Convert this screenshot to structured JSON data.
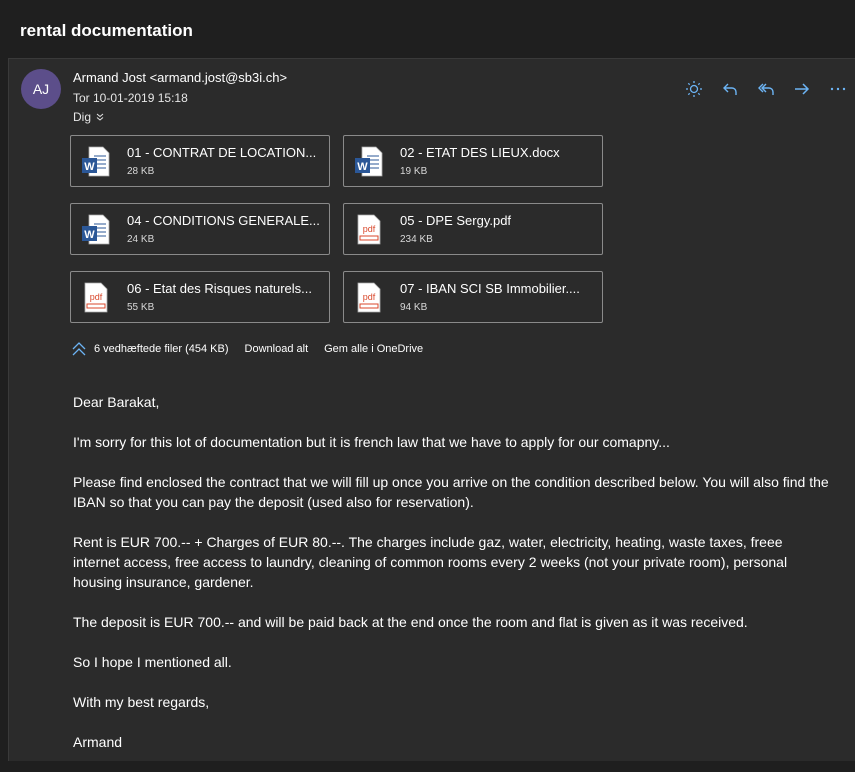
{
  "subject": "rental documentation",
  "message": {
    "avatar_initials": "AJ",
    "sender": "Armand Jost <armand.jost@sb3i.ch>",
    "date": "Tor 10-01-2019 15:18",
    "to_label": "Dig"
  },
  "actions": [
    {
      "icon": "brightness-icon"
    },
    {
      "icon": "reply-icon"
    },
    {
      "icon": "reply-all-icon"
    },
    {
      "icon": "forward-icon"
    },
    {
      "icon": "more-icon"
    }
  ],
  "attachments": [
    {
      "name": "01 - CONTRAT DE LOCATION...",
      "size": "28 KB",
      "type": "word"
    },
    {
      "name": "02 - ETAT DES LIEUX.docx",
      "size": "19 KB",
      "type": "word"
    },
    {
      "name": "04 - CONDITIONS GENERALE...",
      "size": "24 KB",
      "type": "word"
    },
    {
      "name": "05 - DPE Sergy.pdf",
      "size": "234 KB",
      "type": "pdf"
    },
    {
      "name": "06 - Etat des Risques naturels...",
      "size": "55 KB",
      "type": "pdf"
    },
    {
      "name": "07 - IBAN SCI SB Immobilier....",
      "size": "94 KB",
      "type": "pdf"
    }
  ],
  "attachment_summary": {
    "count_text": "6 vedhæftede filer (454 KB)",
    "download_all": "Download alt",
    "save_onedrive": "Gem alle i OneDrive"
  },
  "body": {
    "greeting": "Dear Barakat,",
    "p1": "I'm sorry for this lot of documentation but it is french law that we have to apply for our comapny...",
    "p2": "Please find enclosed the contract that we will fill up once you arrive on the condition described below. You will also find the IBAN so that you can pay the deposit (used also for reservation).",
    "p3": "Rent is EUR 700.-- + Charges of EUR 80.--. The charges include gaz, water, electricity, heating, waste taxes, freee internet access, free access to laundry, cleaning of common rooms every 2 weeks (not your private room), personal housing insurance, gardener.",
    "p4": "The deposit is EUR 700.-- and will be paid back at the end once the room and flat is given as it was received.",
    "p5": "So I hope I mentioned all.",
    "closing": "With my best regards,",
    "signature": "Armand"
  },
  "colors": {
    "background": "#1f1f1f",
    "panel": "#2b2b2b",
    "accent": "#6cb4f5",
    "avatar": "#5c4e8a",
    "word_blue": "#2b5797",
    "pdf_red": "#d9472b"
  }
}
